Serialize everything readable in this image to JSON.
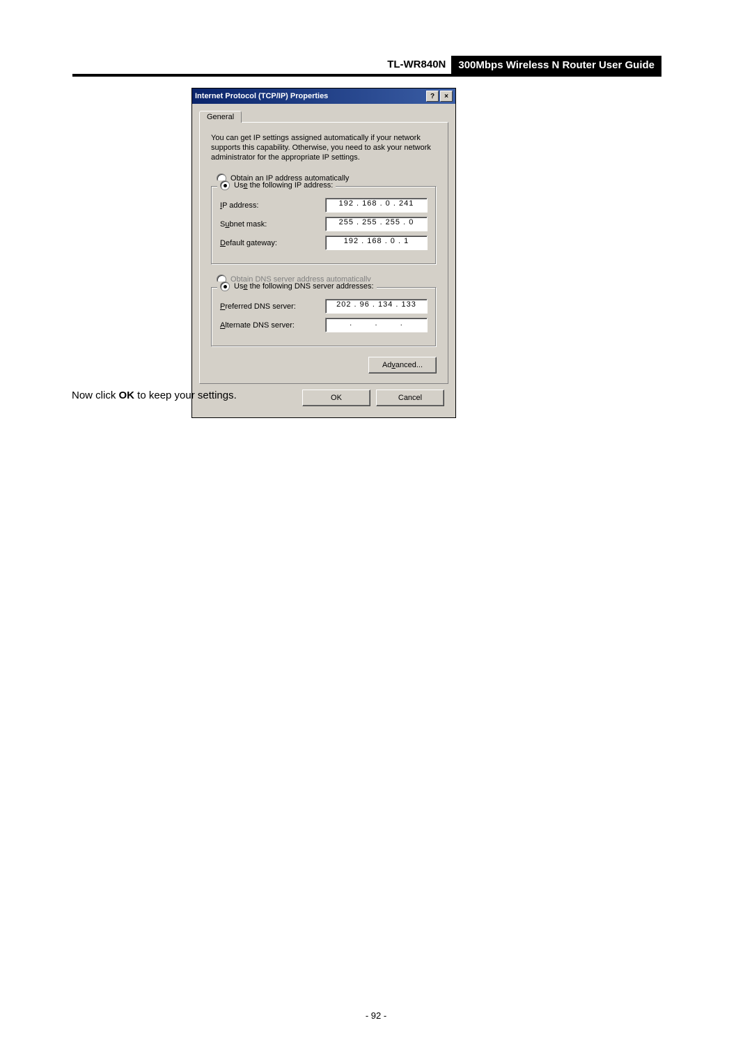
{
  "header": {
    "model": "TL-WR840N",
    "title": "300Mbps Wireless N Router User Guide"
  },
  "dialog": {
    "title": "Internet Protocol (TCP/IP) Properties",
    "help_btn": "?",
    "close_btn": "×",
    "tab": "General",
    "description": "You can get IP settings assigned automatically if your network supports this capability. Otherwise, you need to ask your network administrator for the appropriate IP settings.",
    "radio_obtain_ip_prefix": "O",
    "radio_obtain_ip_rest": "btain an IP address automatically",
    "radio_use_ip_prefix": "Us",
    "radio_use_ip_underline": "e",
    "radio_use_ip_rest": " the following IP address:",
    "ip_label_prefix": "I",
    "ip_label_rest": "P address:",
    "ip_value": "192 . 168 .  0  . 241",
    "subnet_label_prefix": "S",
    "subnet_label_underline": "u",
    "subnet_label_rest": "bnet mask:",
    "subnet_value": "255 . 255 . 255 .  0 ",
    "gateway_label_underline": "D",
    "gateway_label_rest": "efault gateway:",
    "gateway_value": "192 . 168 .  0  .  1 ",
    "radio_obtain_dns_prefix": "O",
    "radio_obtain_dns_underline": "b",
    "radio_obtain_dns_rest": "tain DNS server address automatically",
    "radio_use_dns_prefix": "Us",
    "radio_use_dns_underline": "e",
    "radio_use_dns_rest": " the following DNS server addresses:",
    "pref_dns_underline": "P",
    "pref_dns_rest": "referred DNS server:",
    "pref_dns_value": "202 .  96 . 134 . 133",
    "alt_dns_underline": "A",
    "alt_dns_rest": "lternate DNS server:",
    "advanced_prefix": "Ad",
    "advanced_underline": "v",
    "advanced_rest": "anced...",
    "ok": "OK",
    "cancel": "Cancel"
  },
  "instruction_prefix": "Now click ",
  "instruction_bold": "OK",
  "instruction_suffix": " to keep your settings.",
  "page_number": "- 92 -"
}
